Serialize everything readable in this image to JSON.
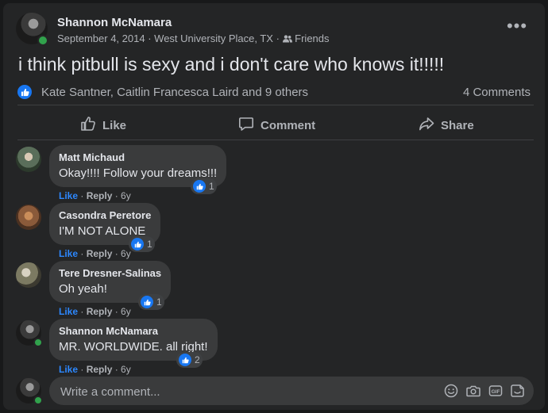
{
  "post": {
    "author": "Shannon McNamara",
    "date": "September 4, 2014",
    "location": "West University Place, TX",
    "privacy": "Friends",
    "text": "i think pitbull is sexy and i don't care who knows it!!!!!",
    "reactors": "Kate Santner, Caitlin Francesca Laird and 9 others",
    "comment_count": "4 Comments"
  },
  "actions": {
    "like": "Like",
    "comment": "Comment",
    "share": "Share"
  },
  "comments": [
    {
      "name": "Matt Michaud",
      "text": "Okay!!!! Follow your dreams!!!",
      "reactions": "1",
      "like": "Like",
      "reply": "Reply",
      "time": "6y"
    },
    {
      "name": "Casondra Peretore",
      "text": "I'M NOT ALONE",
      "reactions": "1",
      "like": "Like",
      "reply": "Reply",
      "time": "6y"
    },
    {
      "name": "Tere Dresner-Salinas",
      "text": "Oh yeah!",
      "reactions": "1",
      "like": "Like",
      "reply": "Reply",
      "time": "6y"
    },
    {
      "name": "Shannon McNamara",
      "text": "MR. WORLDWIDE. all right!",
      "reactions": "2",
      "like": "Like",
      "reply": "Reply",
      "time": "6y"
    }
  ],
  "composer": {
    "placeholder": "Write a comment..."
  },
  "icons": [
    "more-icon",
    "friends-icon",
    "like-reaction-icon",
    "like-icon",
    "comment-icon",
    "share-icon",
    "emoji-icon",
    "camera-icon",
    "gif-icon",
    "sticker-icon"
  ],
  "colors": {
    "accent": "#1877f2",
    "link": "#2d88ff",
    "online": "#31a24c",
    "card": "#242526",
    "bubble": "#3a3b3c"
  }
}
